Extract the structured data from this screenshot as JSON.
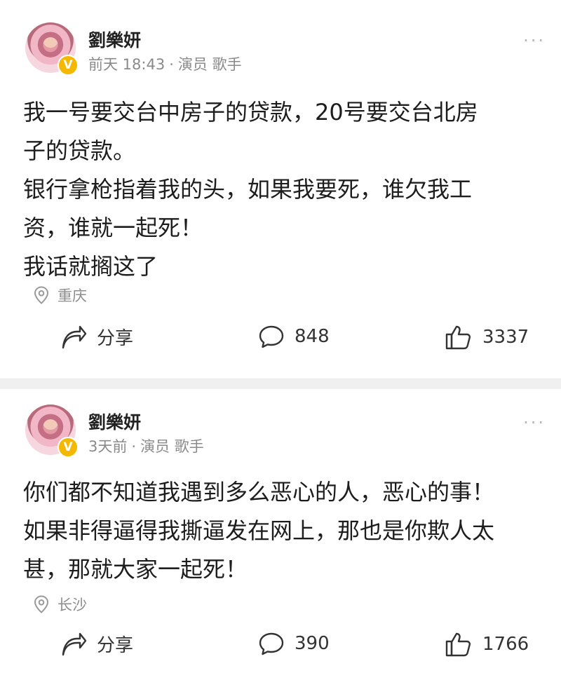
{
  "posts": [
    {
      "username": "劉樂妍",
      "time": "前天 18:43",
      "separator": "·",
      "tags": "演员 歌手",
      "content_lines": [
        "我一号要交台中房子的贷款，20号要交台北房",
        "子的贷款。",
        "银行拿枪指着我的头，如果我要死，谁欠我工",
        "资，谁就一起死！",
        "我话就搁这了"
      ],
      "location": "重庆",
      "share_label": "分享",
      "comments": "848",
      "likes": "3337",
      "more": "···"
    },
    {
      "username": "劉樂妍",
      "time": "3天前",
      "separator": "·",
      "tags": "演员 歌手",
      "content_lines": [
        "你们都不知道我遇到多么恶心的人，恶心的事！",
        "如果非得逼得我撕逼发在网上，那也是你欺人太",
        "甚，那就大家一起死！"
      ],
      "location": "长沙",
      "share_label": "分享",
      "comments": "390",
      "likes": "1766",
      "more": "···"
    }
  ],
  "icons": {
    "avatar_badge": "V",
    "location": "location-pin-icon",
    "share": "share-arrow-icon",
    "comment": "comment-bubble-icon",
    "like": "thumbs-up-icon"
  },
  "colors": {
    "verified_badge": "#f5b800",
    "meta_text": "#8a8a8a",
    "divider": "#f0f0f0"
  }
}
